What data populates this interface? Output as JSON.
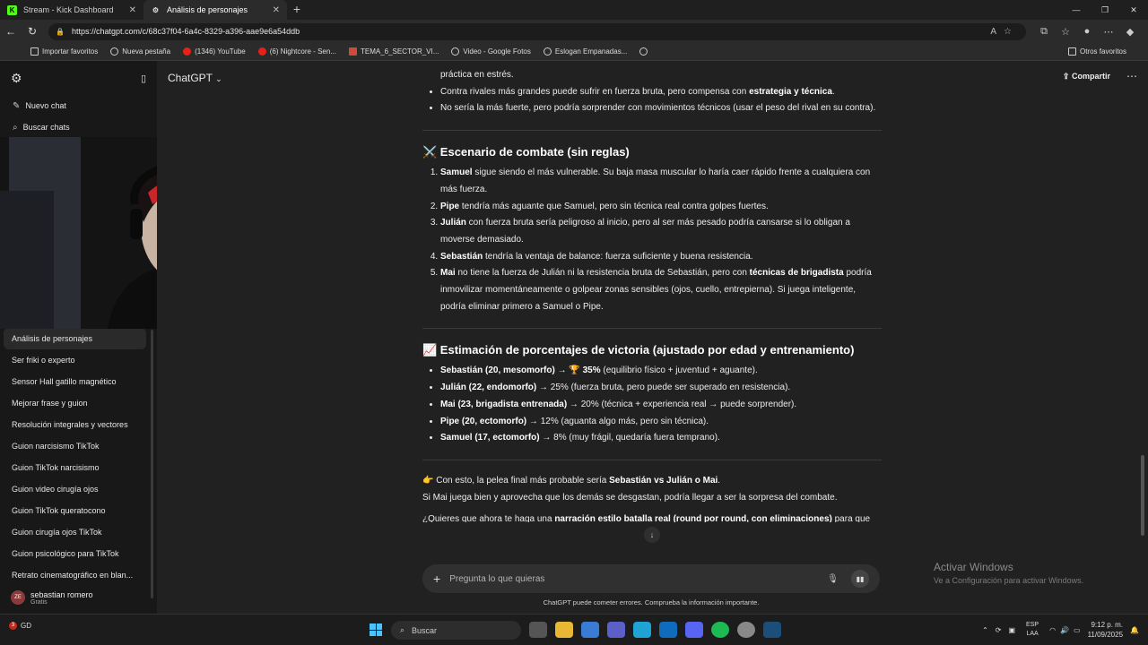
{
  "browser": {
    "tabs": [
      {
        "title": "Stream - Kick Dashboard",
        "icon": "kick-icon",
        "active": false
      },
      {
        "title": "Análisis de personajes",
        "icon": "chatgpt-icon",
        "active": true
      }
    ],
    "url": "https://chatgpt.com/c/68c37f04-6a4c-8329-a396-aae9e6a54ddb",
    "bookmarks": [
      "Importar favoritos",
      "Nueva pestaña",
      "(1346) YouTube",
      "(6) Nightcore - Sen...",
      "TEMA_6_SECTOR_VI...",
      "Video - Google Fotos",
      "Eslogan Empanadas..."
    ],
    "other_favorites": "Otros favoritos"
  },
  "sidebar": {
    "new_chat": "Nuevo chat",
    "search_chats": "Buscar chats",
    "items": [
      "Análisis de personajes",
      "Ser friki o experto",
      "Sensor Hall gatillo magnético",
      "Mejorar frase y guion",
      "Resolución integrales y vectores",
      "Guion narcisismo TikTok",
      "Guion TikTok narcisismo",
      "Guion video cirugía ojos",
      "Guion TikTok queratocono",
      "Guion cirugía ojos TikTok",
      "Guion psicológico para TikTok",
      "Retrato cinematográfico en blan..."
    ],
    "user": {
      "initials": "ZE",
      "name": "sebastian romero",
      "plan": "Gratis"
    }
  },
  "header": {
    "title": "ChatGPT",
    "share": "Compartir"
  },
  "message": {
    "intro_bullets": [
      {
        "pre": "práctica en estrés.",
        "b": "",
        "post": ""
      },
      {
        "pre": "Contra rivales más grandes puede sufrir en fuerza bruta, pero compensa con ",
        "b": "estrategia y técnica",
        "post": "."
      },
      {
        "pre": "No sería la más fuerte, pero podría sorprender con movimientos técnicos (usar el peso del rival en su contra).",
        "b": "",
        "post": ""
      }
    ],
    "combat_title": "⚔️ Escenario de combate (sin reglas)",
    "combat": [
      {
        "b": "Samuel",
        "post": " sigue siendo el más vulnerable. Su baja masa muscular lo haría caer rápido frente a cualquiera con más fuerza."
      },
      {
        "b": "Pipe",
        "post": " tendría más aguante que Samuel, pero sin técnica real contra golpes fuertes."
      },
      {
        "b": "Julián",
        "post": " con fuerza bruta sería peligroso al inicio, pero al ser más pesado podría cansarse si lo obligan a moverse demasiado."
      },
      {
        "b": "Sebastián",
        "post": " tendría la ventaja de balance: fuerza suficiente y buena resistencia."
      },
      {
        "b": "Mai",
        "post": " no tiene la fuerza de Julián ni la resistencia bruta de Sebastián, pero con ",
        "b2": "técnicas de brigadista",
        "post2": " podría inmovilizar momentáneamente o golpear zonas sensibles (ojos, cuello, entrepierna). Si juega inteligente, podría eliminar primero a Samuel o Pipe."
      }
    ],
    "estimate_title": "📈 Estimación de porcentajes de victoria (ajustado por edad y entrenamiento)",
    "estimates": [
      {
        "b": "Sebastián (20, mesomorfo)",
        "arrow": " → 🏆 ",
        "b2": "35%",
        "post": " (equilibrio físico + juventud + aguante)."
      },
      {
        "b": "Julián (22, endomorfo)",
        "arrow": " → ",
        "b2": "",
        "post": "25% (fuerza bruta, pero puede ser superado en resistencia)."
      },
      {
        "b": "Mai (23, brigadista entrenada)",
        "arrow": " → ",
        "b2": "",
        "post": "20% (técnica + experiencia real → puede sorprender)."
      },
      {
        "b": "Pipe (20, ectomorfo)",
        "arrow": " → ",
        "b2": "",
        "post": "12% (aguanta algo más, pero sin técnica)."
      },
      {
        "b": "Samuel (17, ectomorfo)",
        "arrow": " → ",
        "b2": "",
        "post": "8% (muy frágil, quedaría fuera temprano)."
      }
    ],
    "conclusion_pre": "👉 Con esto, la pelea final más probable sería ",
    "conclusion_b": "Sebastián vs Julián o Mai",
    "conclusion_post": ".",
    "conclusion2": "Si Mai juega bien y aprovecha que los demás se desgastan, podría llegar a ser la sorpresa del combate.",
    "question_pre": "¿Quieres que ahora te haga una ",
    "question_b": "narración estilo batalla real (round por round, con eliminaciones)",
    "question_post": " para que"
  },
  "composer": {
    "placeholder": "Pregunta lo que quieras",
    "disclaimer": "ChatGPT puede cometer errores. Comprueba la información importante."
  },
  "watermark": {
    "line1": "Activar Windows",
    "line2": "Ve a Configuración para activar Windows."
  },
  "taskbar": {
    "weather_badge": "3",
    "weather_text": "GD",
    "search": "Buscar",
    "lang_line1": "ESP",
    "lang_line2": "LAA",
    "time": "9:12 p. m.",
    "date": "11/09/2025"
  },
  "colors": {
    "bg": "#212121",
    "sidebar": "#181818",
    "accent": "#4cc2ff"
  }
}
